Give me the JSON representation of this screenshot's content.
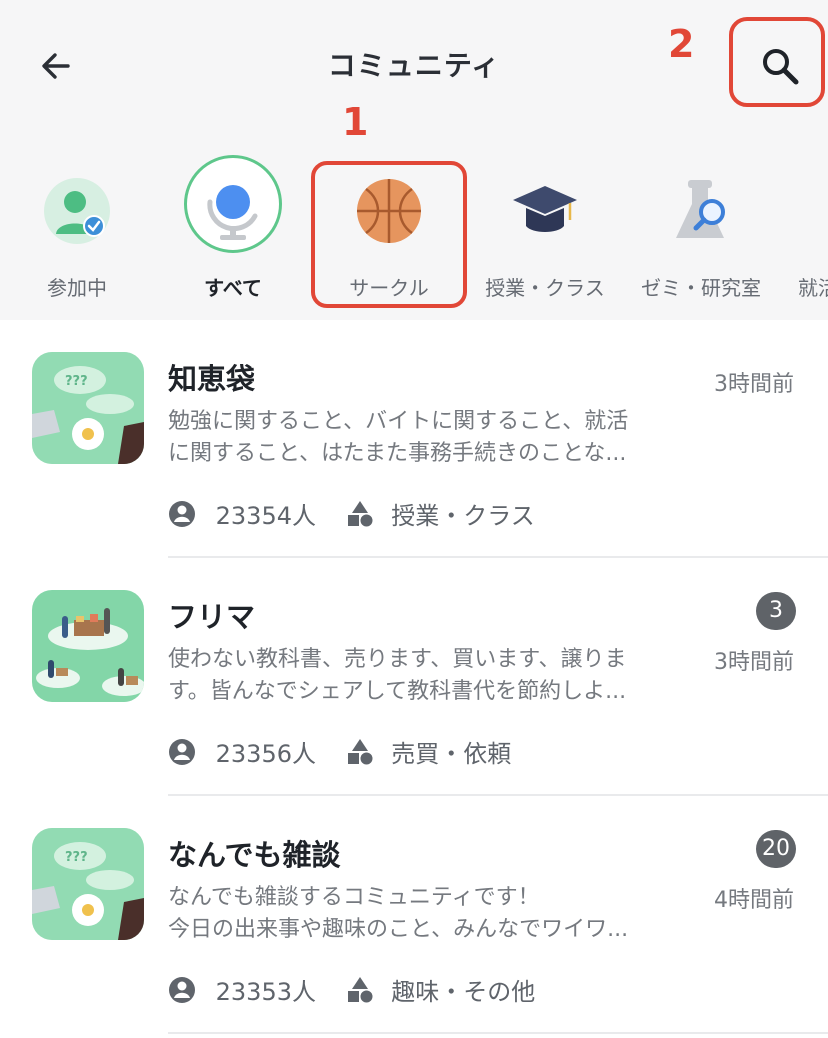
{
  "header": {
    "title": "コミュニティ"
  },
  "annotations": {
    "one": "1",
    "two": "2"
  },
  "categories": [
    {
      "label": "参加中",
      "icon": "participating-user-icon"
    },
    {
      "label": "すべて",
      "icon": "globe-icon"
    },
    {
      "label": "サークル",
      "icon": "basketball-icon"
    },
    {
      "label": "授業・クラス",
      "icon": "graduation-cap-icon"
    },
    {
      "label": "ゼミ・研究室",
      "icon": "flask-search-icon"
    },
    {
      "label": "就活",
      "icon": "briefcase-icon"
    }
  ],
  "communities": [
    {
      "title": "知恵袋",
      "desc1": "勉強に関すること、バイトに関すること、就活",
      "desc2": "に関すること、はたまた事務手続きのことな...",
      "time": "3時間前",
      "badge": "",
      "members": "23354人",
      "category": "授業・クラス"
    },
    {
      "title": "フリマ",
      "desc1": "使わない教科書、売ります、買います、譲りま",
      "desc2": "す。皆んなでシェアして教科書代を節約しよ...",
      "time": "3時間前",
      "badge": "3",
      "members": "23356人",
      "category": "売買・依頼"
    },
    {
      "title": "なんでも雑談",
      "desc1": "なんでも雑談するコミュニティです！",
      "desc2": "今日の出来事や趣味のこと、みんなでワイワ...",
      "time": "4時間前",
      "badge": "20",
      "members": "23353人",
      "category": "趣味・その他"
    }
  ],
  "colors": {
    "annotation_red": "#e14737",
    "selected_ring": "#5ec78b",
    "badge_bg": "#5f6368"
  }
}
